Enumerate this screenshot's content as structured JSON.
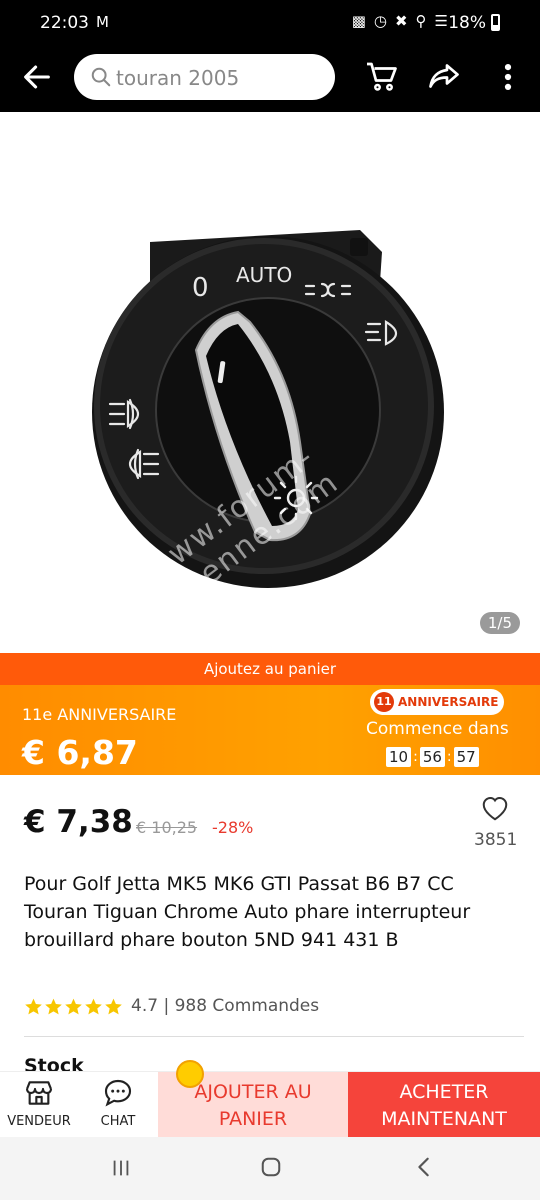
{
  "status_bar": {
    "time": "22:03",
    "left_icon": "gmail-icon",
    "battery": "18%"
  },
  "search": {
    "query": "touran 2005"
  },
  "gallery": {
    "counter": "1/5",
    "switch_labels": {
      "off": "0",
      "auto": "AUTO"
    }
  },
  "promo": {
    "add_to_cart_strip": "Ajoutez au panier",
    "label": "11e ANNIVERSAIRE",
    "price": "€ 6,87",
    "badge_num": "11",
    "badge_text": "ANNIVERSAIRE",
    "countdown_label": "Commence dans",
    "countdown": {
      "h": "10",
      "m": "56",
      "s": "57"
    }
  },
  "product": {
    "price": "€ 7,38",
    "old_price": "€ 10,25",
    "discount": "-28%",
    "wishlist_count": "3851",
    "title": "Pour Golf Jetta MK5 MK6 GTI Passat B6 B7 CC Touran Tiguan Chrome Auto phare interrupteur brouillard phare bouton 5ND 941 431 B",
    "rating": "4.7",
    "orders": "988 Commandes",
    "rating_line": "4.7 | 988 Commandes",
    "stars": 5,
    "stock_label": "Stock"
  },
  "actions": {
    "vendor": "VENDEUR",
    "chat": "CHAT",
    "add_to_cart": "AJOUTER AU PANIER",
    "buy_now": "ACHETER MAINTENANT"
  },
  "watermark": "www.forum-ayenne.com",
  "colors": {
    "accent": "#ff5a0a",
    "promo": "#ff9900",
    "red": "#f5443b",
    "discount": "#e83a2e"
  }
}
